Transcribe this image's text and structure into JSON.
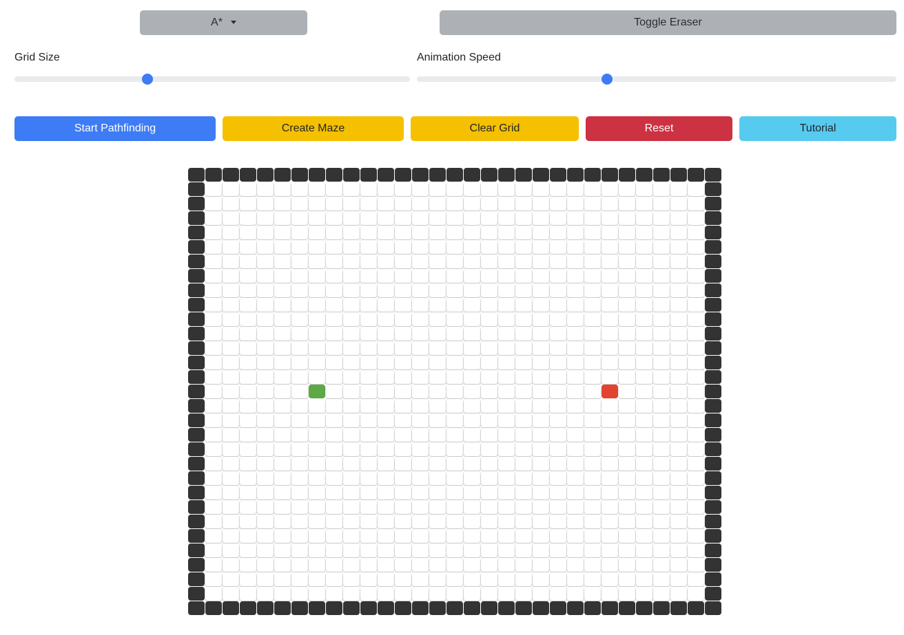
{
  "algorithm_dropdown": {
    "selected": "A*"
  },
  "toggle_eraser": {
    "label": "Toggle Eraser"
  },
  "grid_size": {
    "label": "Grid Size",
    "value_fraction": 0.336
  },
  "animation_speed": {
    "label": "Animation Speed",
    "value_fraction": 0.397
  },
  "actions": {
    "start_pathfinding": "Start Pathfinding",
    "create_maze": "Create Maze",
    "clear_grid": "Clear Grid",
    "reset": "Reset",
    "tutorial": "Tutorial"
  },
  "colors": {
    "primary": "#3e7cf6",
    "warning": "#f5c000",
    "danger": "#cc3242",
    "info": "#57caf0",
    "secondary": "#adb0b5",
    "wall": "#333333",
    "start_node": "#5fa846",
    "end_node": "#e3442f"
  },
  "grid": {
    "rows": 31,
    "cols": 31,
    "border_walls": true,
    "start_node": {
      "row": 15,
      "col": 7
    },
    "end_node": {
      "row": 15,
      "col": 24
    }
  }
}
